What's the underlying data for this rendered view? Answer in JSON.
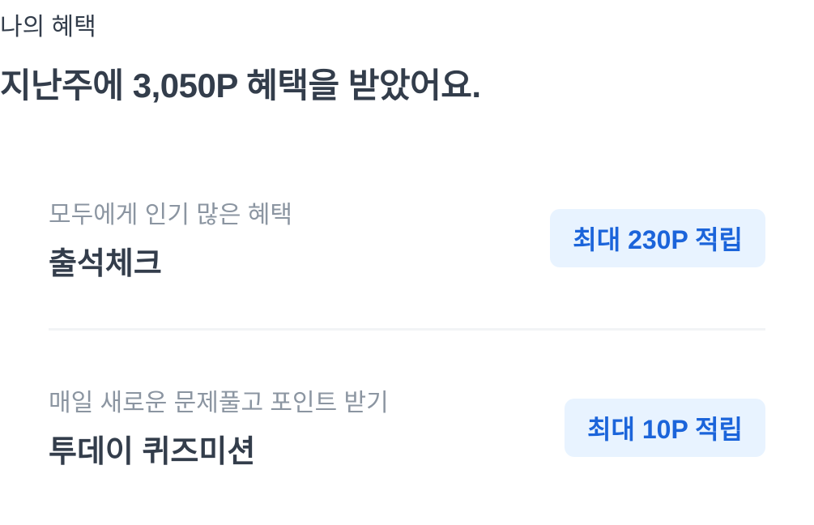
{
  "header": {
    "section_label": "나의 혜택",
    "headline": "지난주에 3,050P 혜택을 받았어요."
  },
  "items": [
    {
      "subtitle": "모두에게 인기 많은 혜택",
      "title": "출석체크",
      "badge": "최대 230P 적립"
    },
    {
      "subtitle": "매일 새로운 문제풀고 포인트 받기",
      "title": "투데이 퀴즈미션",
      "badge": "최대 10P 적립"
    }
  ],
  "colors": {
    "badge_bg": "#e8f3ff",
    "badge_text": "#1b64da",
    "subtitle": "#8b95a1",
    "title": "#333d4b"
  }
}
